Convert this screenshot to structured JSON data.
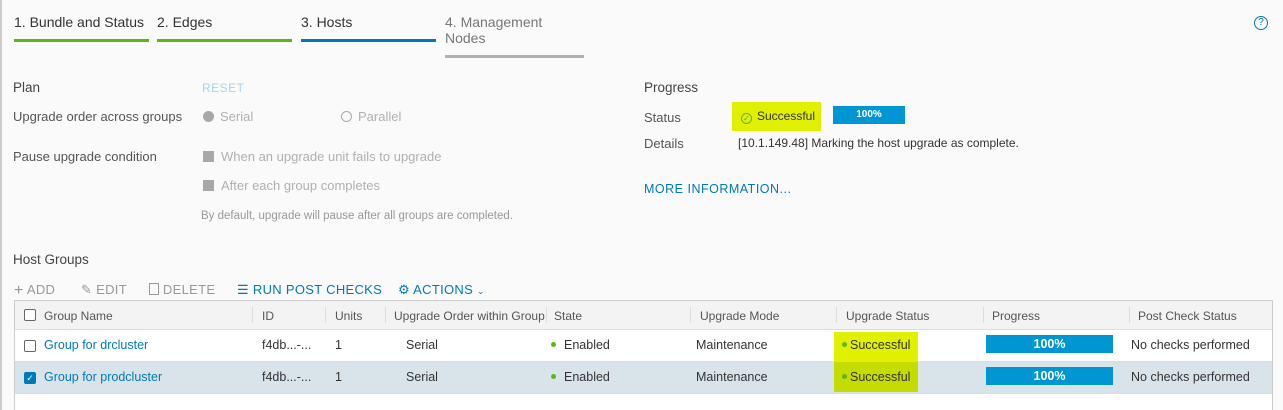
{
  "tabs": [
    {
      "label": "1. Bundle and Status",
      "color": "#60b515"
    },
    {
      "label": "2. Edges",
      "color": "#60b515"
    },
    {
      "label": "3. Hosts",
      "color": "#0079b8"
    },
    {
      "label": "4. Management Nodes",
      "color": "#b0b0b0"
    }
  ],
  "help_label": "?",
  "plan": {
    "title": "Plan",
    "reset": "RESET",
    "order_label": "Upgrade order across groups",
    "serial": "Serial",
    "parallel": "Parallel",
    "pause_label": "Pause upgrade condition",
    "pause_opt1": "When an upgrade unit fails to upgrade",
    "pause_opt2": "After each group completes",
    "note": "By default, upgrade will pause after all groups are completed."
  },
  "progress": {
    "title": "Progress",
    "status_label": "Status",
    "status": "Successful",
    "percent_text": "100%",
    "percent": 100,
    "details_label": "Details",
    "details": "[10.1.149.48] Marking the host upgrade as complete.",
    "more": "MORE INFORMATION..."
  },
  "host_groups": {
    "title": "Host Groups",
    "toolbar": {
      "add": "ADD",
      "edit": "EDIT",
      "delete": "DELETE",
      "run": "RUN POST CHECKS",
      "actions": "ACTIONS"
    },
    "columns": [
      "Group Name",
      "ID",
      "Units",
      "Upgrade Order within Group",
      "State",
      "Upgrade Mode",
      "Upgrade Status",
      "Progress",
      "Post Check Status"
    ],
    "rows": [
      {
        "name": "Group for drcluster",
        "id": "f4db...-...",
        "units": "1",
        "order": "Serial",
        "state": "Enabled",
        "mode": "Maintenance",
        "status": "Successful",
        "progress": "100%",
        "post": "No checks performed",
        "selected": false
      },
      {
        "name": "Group for prodcluster",
        "id": "f4db...-...",
        "units": "1",
        "order": "Serial",
        "state": "Enabled",
        "mode": "Maintenance",
        "status": "Successful",
        "progress": "100%",
        "post": "No checks performed",
        "selected": true
      }
    ]
  }
}
